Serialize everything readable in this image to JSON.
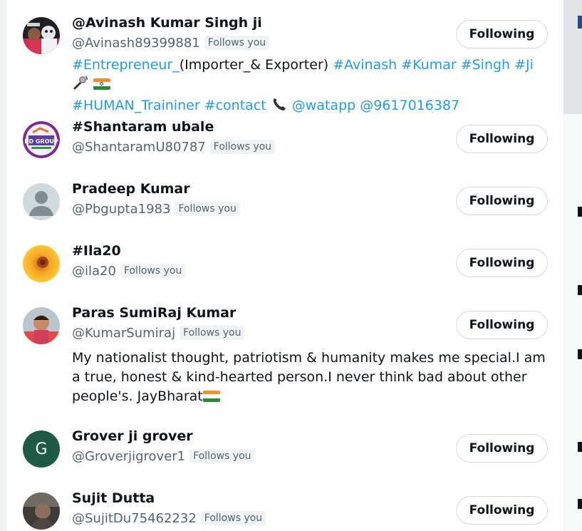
{
  "users": [
    {
      "name": "@Avinash Kumar Singh ji",
      "handle": "@Avinash89399881",
      "follows_you": "Follows you",
      "button": "Following",
      "bio_line1": [
        "#Entrepreneur_",
        "(Importer_& Exporter) ",
        "#Avinash #Kumar #Singh #Ji"
      ],
      "bio_line2": [
        "#HUMAN_Traininer #contact",
        "@watapp @9617016387"
      ],
      "avatar_icon": "person-photo-avatar"
    },
    {
      "name": "#Shantaram ubale",
      "handle": "@ShantaramU80787",
      "follows_you": "Follows you",
      "button": "Following",
      "avatar_text": "RD GROUP"
    },
    {
      "name": "Pradeep Kumar",
      "handle": "@Pbgupta1983",
      "follows_you": "Follows you",
      "button": "Following",
      "avatar_icon": "default-profile-avatar"
    },
    {
      "name": "#Ila20",
      "handle": "@ila20",
      "follows_you": "Follows you",
      "button": "Following",
      "avatar_icon": "sunflower-avatar"
    },
    {
      "name": "Paras SumiRaj Kumar",
      "handle": "@KumarSumiraj",
      "follows_you": "Follows you",
      "button": "Following",
      "bio": "My nationalist thought, patriotism & humanity makes me special.I am a true, honest & kind-hearted person.I never think bad about other people's. JayBharat",
      "avatar_icon": "person-photo-avatar"
    },
    {
      "name": "Grover ji grover",
      "handle": "@Groverjigrover1",
      "follows_you": "Follows you",
      "button": "Following",
      "avatar_letter": "G",
      "avatar_color": "#1e5b46"
    },
    {
      "name": "Sujit Dutta",
      "handle": "@SujitDu75462232",
      "follows_you": "Follows you",
      "button": "Following",
      "avatar_icon": "person-photo-avatar"
    }
  ],
  "colors": {
    "link": "#1d9bf0",
    "secondary_text": "#536471",
    "badge_bg": "#eff3f4",
    "button_border": "#cfd9de"
  }
}
